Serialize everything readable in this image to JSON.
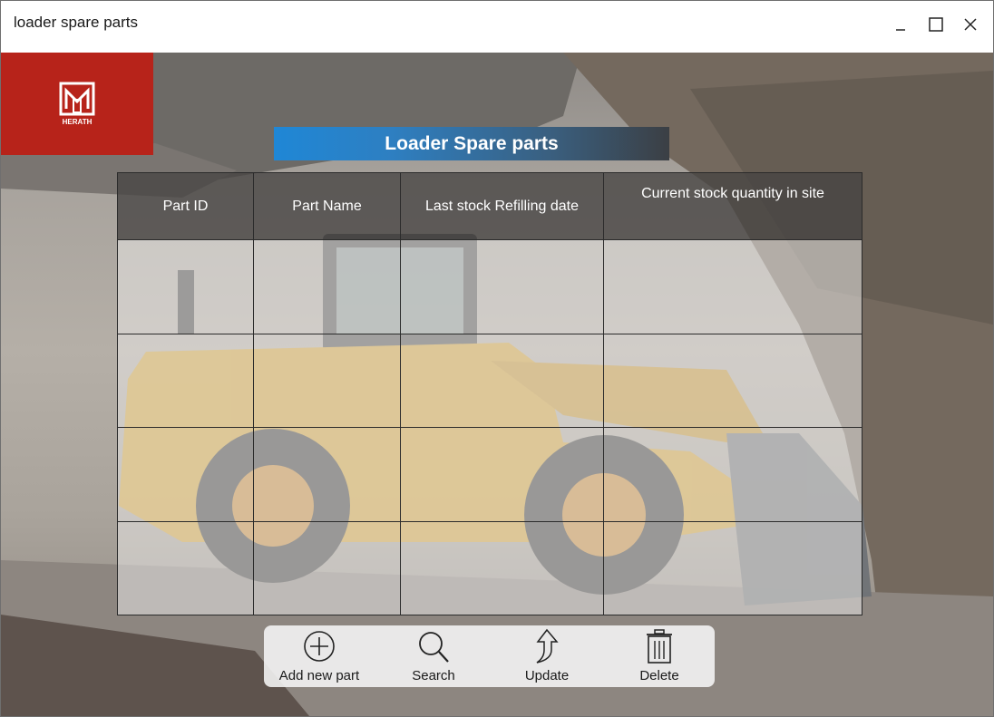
{
  "window": {
    "title": "loader spare parts"
  },
  "logo": {
    "brand": "HERATH"
  },
  "heading": "Loader Spare parts",
  "table": {
    "columns": [
      "Part ID",
      "Part Name",
      "Last stock Refilling date",
      "Current stock quantity in site"
    ],
    "rows": [
      [
        "",
        "",
        "",
        ""
      ],
      [
        "",
        "",
        "",
        ""
      ],
      [
        "",
        "",
        "",
        ""
      ],
      [
        "",
        "",
        "",
        ""
      ]
    ]
  },
  "toolbar": {
    "add_label": "Add new part",
    "search_label": "Search",
    "update_label": "Update",
    "delete_label": "Delete",
    "add_icon": "plus-circle-icon",
    "search_icon": "magnifier-icon",
    "update_icon": "arrow-up-icon",
    "delete_icon": "trash-icon"
  },
  "colors": {
    "logo_bg": "#b7231a",
    "heading_blue": "#1f87d6"
  }
}
